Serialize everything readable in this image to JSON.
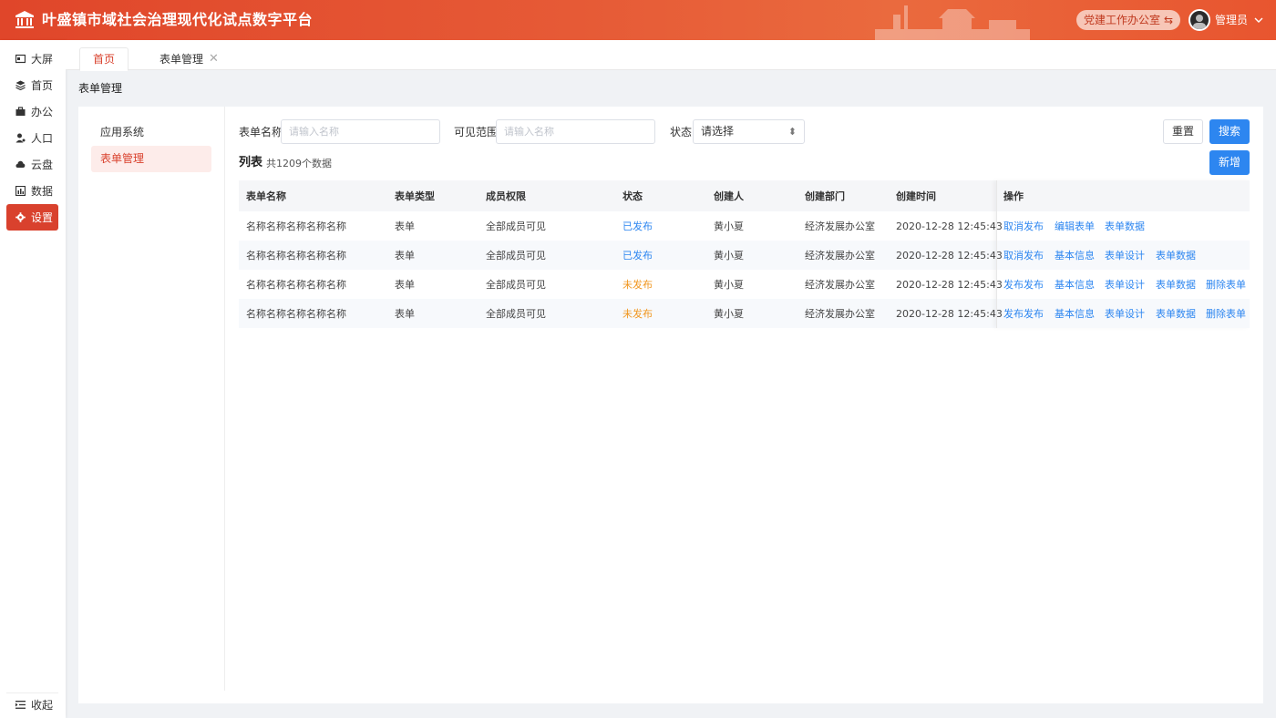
{
  "header": {
    "title": "叶盛镇市域社会治理现代化试点数字平台",
    "office_button": "党建工作办公室",
    "user_name": "管理员",
    "brand_color": "#e0462a"
  },
  "sidebar": {
    "items": [
      {
        "label": "大屏",
        "icon": "screen-icon"
      },
      {
        "label": "首页",
        "icon": "layers-icon"
      },
      {
        "label": "办公",
        "icon": "briefcase-icon"
      },
      {
        "label": "人口",
        "icon": "person-icon"
      },
      {
        "label": "云盘",
        "icon": "cloud-icon"
      },
      {
        "label": "数据",
        "icon": "chart-icon"
      },
      {
        "label": "设置",
        "icon": "gear-icon",
        "active": true
      }
    ],
    "collapse_label": "收起"
  },
  "tabs": {
    "home": "首页",
    "form_mgmt": "表单管理",
    "close_symbol": "✕"
  },
  "breadcrumb": "表单管理",
  "left_menu": {
    "items": [
      "应用系统",
      "表单管理"
    ],
    "active_index": 1
  },
  "filters": {
    "name_label": "表单名称",
    "name_placeholder": "请输入名称",
    "scope_label": "可见范围",
    "scope_placeholder": "请输入名称",
    "status_label": "状态",
    "status_value": "请选择",
    "reset": "重置",
    "search": "搜索",
    "add": "新增"
  },
  "list": {
    "title": "列表",
    "count_text": "共1209个数据"
  },
  "table": {
    "headers": [
      "表单名称",
      "表单类型",
      "成员权限",
      "状态",
      "创建人",
      "创建部门",
      "创建时间",
      "操作"
    ],
    "rows": [
      {
        "name": "名称名称名称名称名称",
        "type": "表单",
        "perm": "全部成员可见",
        "status": "已发布",
        "published": true,
        "creator": "黄小夏",
        "dept": "经济发展办公室",
        "time": "2020-12-28 12:45:43",
        "ops": [
          "取消发布",
          "编辑表单",
          "表单数据"
        ]
      },
      {
        "name": "名称名称名称名称名称",
        "type": "表单",
        "perm": "全部成员可见",
        "status": "已发布",
        "published": true,
        "creator": "黄小夏",
        "dept": "经济发展办公室",
        "time": "2020-12-28 12:45:43",
        "ops": [
          "取消发布",
          "基本信息",
          "表单设计",
          "表单数据"
        ]
      },
      {
        "name": "名称名称名称名称名称",
        "type": "表单",
        "perm": "全部成员可见",
        "status": "未发布",
        "published": false,
        "creator": "黄小夏",
        "dept": "经济发展办公室",
        "time": "2020-12-28 12:45:43",
        "ops": [
          "发布发布",
          "基本信息",
          "表单设计",
          "表单数据",
          "删除表单"
        ]
      },
      {
        "name": "名称名称名称名称名称",
        "type": "表单",
        "perm": "全部成员可见",
        "status": "未发布",
        "published": false,
        "creator": "黄小夏",
        "dept": "经济发展办公室",
        "time": "2020-12-28 12:45:43",
        "ops": [
          "发布发布",
          "基本信息",
          "表单设计",
          "表单数据",
          "删除表单"
        ]
      }
    ]
  },
  "colors": {
    "accent": "#d9412d",
    "primary_blue": "#2d86f0",
    "unpublished": "#f0961e"
  }
}
